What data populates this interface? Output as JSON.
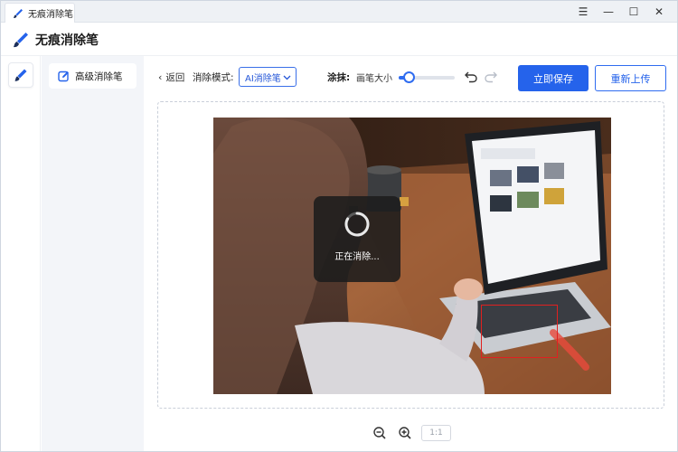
{
  "window": {
    "tab_title": "无痕消除笔",
    "controls": {
      "menu": "☰",
      "minimize": "—",
      "maximize": "☐",
      "close": "✕"
    }
  },
  "app": {
    "title": "无痕消除笔"
  },
  "sidebar": {
    "items": [
      {
        "label": "高级消除笔",
        "icon": "edit-icon",
        "active": true
      }
    ]
  },
  "toolbar": {
    "back_label": "返回",
    "mode_label": "消除模式:",
    "mode_value": "AI消除笔",
    "brush_label": "涂抹:",
    "brush_size_label": "画笔大小",
    "brush_size_fraction": 0.18,
    "save_label": "立即保存",
    "reupload_label": "重新上传"
  },
  "canvas": {
    "processing_message": "正在消除..."
  },
  "zoom": {
    "reset_label": "1:1"
  },
  "colors": {
    "accent": "#2563eb",
    "sidebar_bg": "#f3f5f9",
    "marker": "#e02020"
  }
}
